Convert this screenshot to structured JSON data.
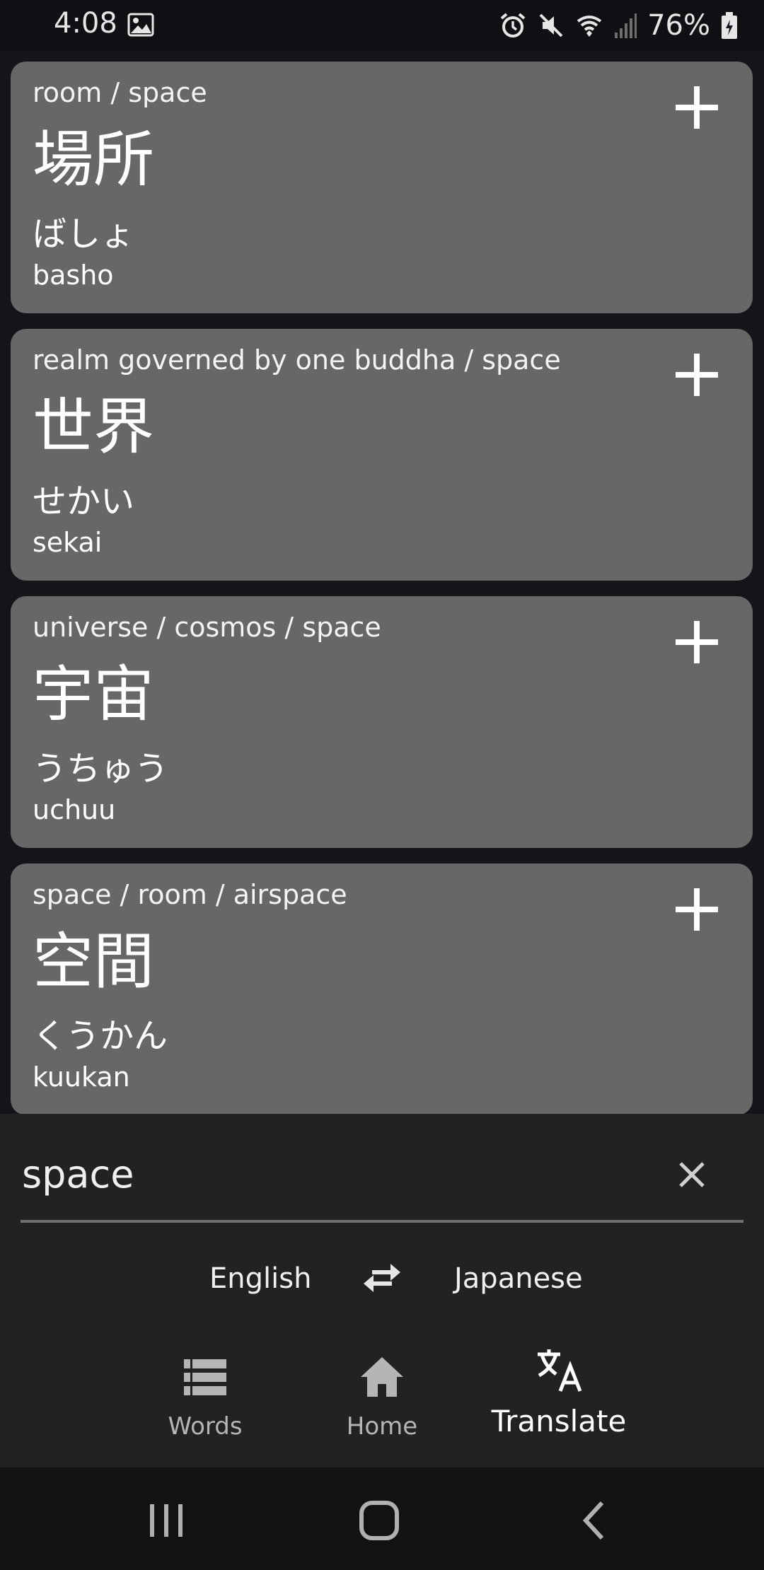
{
  "status_bar": {
    "time": "4:08",
    "battery": "76%"
  },
  "results": [
    {
      "meaning": "room / space",
      "kanji": "場所",
      "kana": "ばしょ",
      "romaji": "basho"
    },
    {
      "meaning": "realm governed by one buddha / space",
      "kanji": "世界",
      "kana": "せかい",
      "romaji": "sekai"
    },
    {
      "meaning": "universe / cosmos / space",
      "kanji": "宇宙",
      "kana": "うちゅう",
      "romaji": "uchuu"
    },
    {
      "meaning": "space / room / airspace",
      "kanji": "空間",
      "kana": "くうかん",
      "romaji": "kuukan"
    }
  ],
  "search": {
    "value": "space"
  },
  "languages": {
    "source": "English",
    "target": "Japanese"
  },
  "bottom_nav": {
    "words": "Words",
    "home": "Home",
    "translate": "Translate",
    "active": "translate"
  },
  "colors": {
    "card_bg": "#676767",
    "panel_bg": "#222222",
    "inactive_nav": "#b5b5b5",
    "active_nav": "#ffffff"
  }
}
